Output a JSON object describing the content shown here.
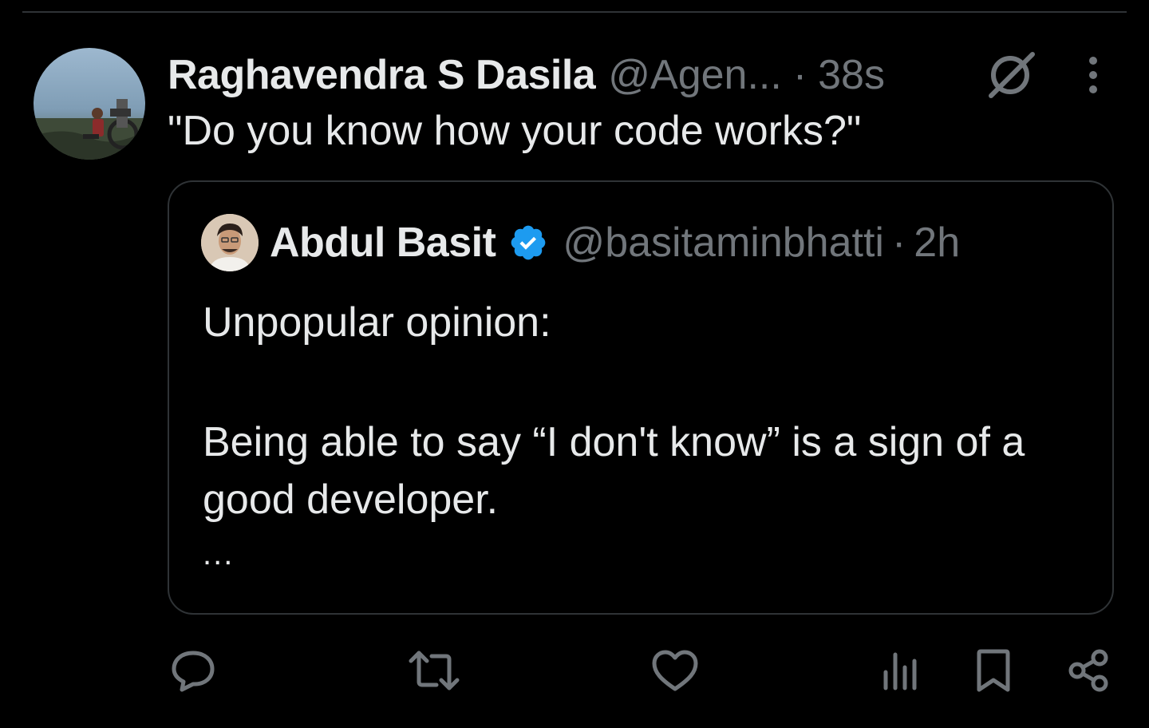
{
  "tweet": {
    "author_name": "Raghavendra S Dasila",
    "author_handle": "@Agen...",
    "separator": "·",
    "time": "38s",
    "text": "\"Do you know how your code works?\""
  },
  "quoted_tweet": {
    "author_name": "Abdul Basit",
    "verified": true,
    "author_handle": "@basitaminbhatti",
    "separator": "·",
    "time": "2h",
    "line1": "Unpopular opinion:",
    "line2": "Being able to say “I don't know” is a sign of a good developer.",
    "truncation": "..."
  },
  "icons": {
    "header": [
      "grok-icon",
      "more-options-icon"
    ],
    "actions": [
      "reply-icon",
      "retweet-icon",
      "like-icon",
      "views-icon",
      "bookmark-icon",
      "share-icon"
    ]
  },
  "colors": {
    "background": "#000000",
    "text_primary": "#e7e9ea",
    "text_secondary": "#71767b",
    "border": "#2f3336",
    "verified_blue": "#1d9bf0"
  }
}
